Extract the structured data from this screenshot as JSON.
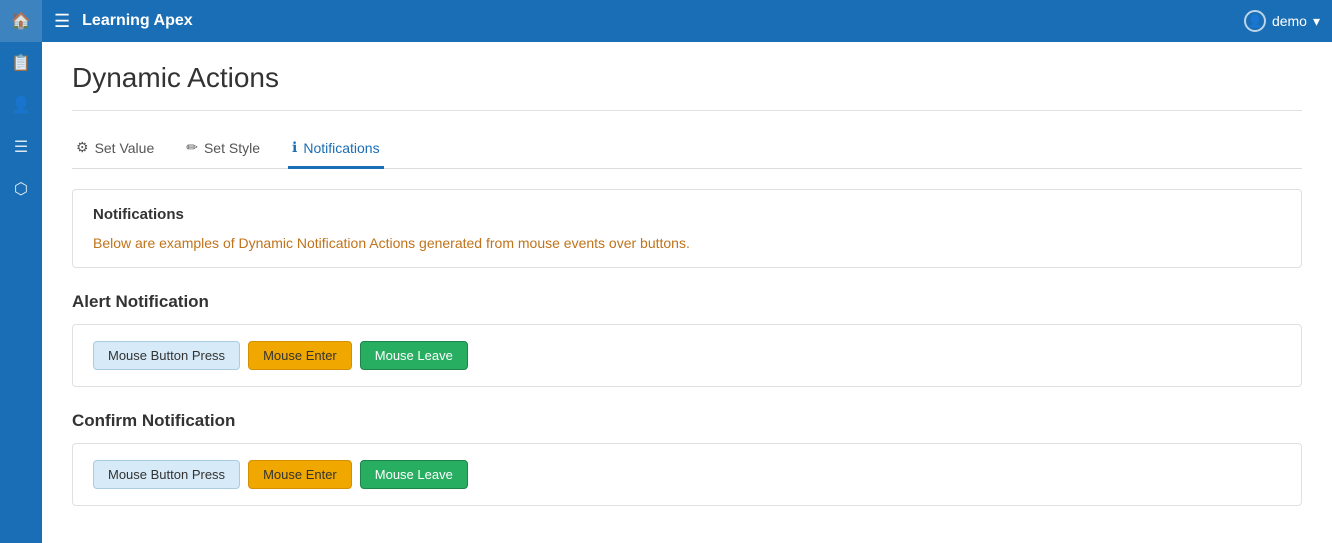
{
  "app": {
    "title": "Learning Apex",
    "user": "demo"
  },
  "sidebar": {
    "icons": [
      "home",
      "copy",
      "users",
      "list",
      "network"
    ]
  },
  "page": {
    "title": "Dynamic Actions"
  },
  "tabs": [
    {
      "id": "set-value",
      "icon": "⚙",
      "label": "Set Value",
      "active": false
    },
    {
      "id": "set-style",
      "icon": "✏",
      "label": "Set Style",
      "active": false
    },
    {
      "id": "notifications",
      "icon": "ℹ",
      "label": "Notifications",
      "active": true
    }
  ],
  "info_box": {
    "title": "Notifications",
    "text": "Below are examples of Dynamic Notification Actions generated from mouse events over buttons."
  },
  "alert_section": {
    "title": "Alert Notification",
    "buttons": [
      {
        "label": "Mouse Button Press",
        "style": "light-blue"
      },
      {
        "label": "Mouse Enter",
        "style": "yellow"
      },
      {
        "label": "Mouse Leave",
        "style": "green"
      }
    ]
  },
  "confirm_section": {
    "title": "Confirm Notification",
    "buttons": [
      {
        "label": "Mouse Button Press",
        "style": "light-blue"
      },
      {
        "label": "Mouse Enter",
        "style": "yellow"
      },
      {
        "label": "Mouse Leave",
        "style": "green"
      }
    ]
  }
}
